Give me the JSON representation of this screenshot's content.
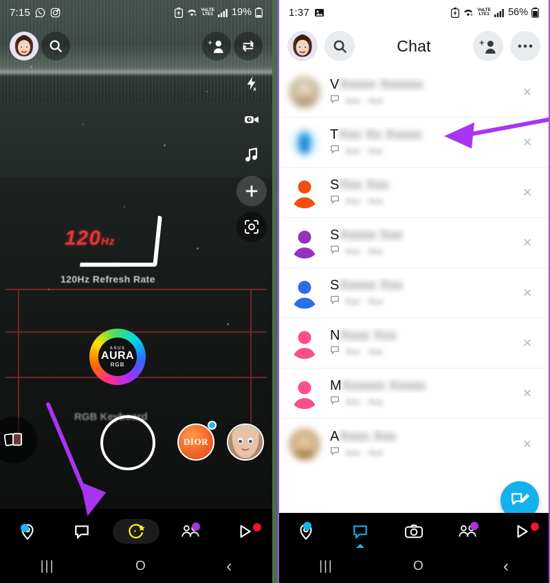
{
  "left_phone": {
    "statusbar": {
      "time": "7:15",
      "icons": [
        "whatsapp-icon",
        "instagram-icon"
      ],
      "right_icons": [
        "battery-saver-icon",
        "wifi-icon",
        "volte-icon",
        "signal-icon"
      ],
      "volte_top": "VoLTE",
      "volte_bottom": "LTE1",
      "battery_percent": "19%"
    },
    "camera": {
      "topbar": {
        "avatar": "bitmoji-avatar",
        "search": "search-icon",
        "add_friend": "add-friend-icon",
        "flip_camera": "flip-camera-icon"
      },
      "tools": [
        {
          "name": "flash-off-icon",
          "label": "Flash off"
        },
        {
          "name": "video-timer-icon",
          "label": "Timer"
        },
        {
          "name": "music-icon",
          "label": "Music"
        },
        {
          "name": "add-icon",
          "label": "Add"
        },
        {
          "name": "scan-icon",
          "label": "Scan"
        }
      ],
      "ar_overlay": {
        "headline": "120",
        "unit": "Hz",
        "caption": "120Hz Refresh Rate",
        "logo_brand": "ASUS",
        "logo_main": "AURA",
        "logo_sub": "RGB",
        "keyboard_text": "RGB Keyboard"
      },
      "carousel": {
        "memories": "memories-icon",
        "shutter": "shutter-button",
        "lenses": [
          {
            "name": "lens-dior",
            "label": "DIOR"
          },
          {
            "name": "lens-face",
            "label": ""
          }
        ]
      }
    },
    "bottom_nav": [
      {
        "name": "nav-map",
        "icon": "location-pin-icon",
        "active": false,
        "badge": ""
      },
      {
        "name": "nav-chat",
        "icon": "chat-bubble-icon",
        "active": false,
        "badge": "blue"
      },
      {
        "name": "nav-camera",
        "icon": "lens-smiley-icon",
        "active": true,
        "badge": ""
      },
      {
        "name": "nav-friends",
        "icon": "friends-icon",
        "active": false,
        "badge": "purple"
      },
      {
        "name": "nav-stories",
        "icon": "play-triangle-icon",
        "active": false,
        "badge": "red"
      }
    ],
    "system_nav": [
      {
        "name": "recents-button",
        "glyph": "|||"
      },
      {
        "name": "home-button",
        "glyph": "O"
      },
      {
        "name": "back-button",
        "glyph": "‹"
      }
    ]
  },
  "right_phone": {
    "statusbar": {
      "time": "1:37",
      "icons": [
        "photo-icon"
      ],
      "right_icons": [
        "battery-saver-icon",
        "wifi-icon",
        "volte-icon",
        "signal-icon"
      ],
      "volte_top": "VoLTE",
      "volte_bottom": "LTE1",
      "battery_percent": "56%"
    },
    "chat_header": {
      "avatar": "bitmoji-avatar",
      "search": "search-icon",
      "title": "Chat",
      "add_friend": "add-friend-icon",
      "more": "more-options-icon"
    },
    "chat_rows": [
      {
        "initial": "V",
        "name_blur": "Xxxxx Xxxxxx",
        "subtitle": "Xxx · Xxx",
        "avatar_type": "photo",
        "avatar_color": "#c8b49a",
        "close": "×"
      },
      {
        "initial": "T",
        "name_blur": "Xxx Xx Xxxxx",
        "subtitle": "Xxx · Xxx",
        "avatar_type": "photo",
        "avatar_color": "#57b6ef",
        "close": "×"
      },
      {
        "initial": "S",
        "name_blur": "Xxx Xxx",
        "subtitle": "Xxx · Xxx",
        "avatar_type": "silhouette",
        "avatar_color": "#f0500f",
        "close": "×"
      },
      {
        "initial": "S",
        "name_blur": "Xxxxx Xxx",
        "subtitle": "Xxx · Xxx",
        "avatar_type": "silhouette",
        "avatar_color": "#9333c0",
        "close": "×"
      },
      {
        "initial": "S",
        "name_blur": "Xxxxx Xxx",
        "subtitle": "Xxx · Xxx",
        "avatar_type": "silhouette",
        "avatar_color": "#2b6ee8",
        "close": "×"
      },
      {
        "initial": "N",
        "name_blur": "Xxxx Xxx",
        "subtitle": "Xxx · Xxx",
        "avatar_type": "silhouette",
        "avatar_color": "#fb4e8e",
        "close": "×"
      },
      {
        "initial": "M",
        "name_blur": "Xxxxxx Xxxxx",
        "subtitle": "Xxx · Xxx",
        "avatar_type": "silhouette",
        "avatar_color": "#fb4e8e",
        "close": "×"
      },
      {
        "initial": "A",
        "name_blur": "Xxxx Xxx",
        "subtitle": "Xxx · Xxx",
        "avatar_type": "photo",
        "avatar_color": "#c39a6b",
        "close": "×"
      }
    ],
    "fab": {
      "name": "new-chat-fab",
      "icon": "compose-chat-icon"
    },
    "bottom_nav": [
      {
        "name": "nav-map",
        "icon": "location-pin-icon",
        "active": false,
        "badge": ""
      },
      {
        "name": "nav-chat",
        "icon": "chat-bubble-icon",
        "active": true,
        "badge": "blue"
      },
      {
        "name": "nav-camera",
        "icon": "camera-icon",
        "active": false,
        "badge": ""
      },
      {
        "name": "nav-friends",
        "icon": "friends-icon",
        "active": false,
        "badge": "purple"
      },
      {
        "name": "nav-stories",
        "icon": "play-triangle-icon",
        "active": false,
        "badge": "red"
      }
    ],
    "system_nav": [
      {
        "name": "recents-button",
        "glyph": "|||"
      },
      {
        "name": "home-button",
        "glyph": "O"
      },
      {
        "name": "back-button",
        "glyph": "‹"
      }
    ]
  },
  "annotations": [
    {
      "name": "arrow-to-chat-tab",
      "color": "#a835f0",
      "direction": "down-right"
    },
    {
      "name": "arrow-to-chat-row",
      "color": "#a835f0",
      "direction": "left"
    }
  ],
  "colors": {
    "background": "#4e6b4f",
    "frame_border": "#a24de8",
    "snap_yellow": "#fffc00",
    "snap_blue": "#13b2ef",
    "badge_purple": "#a835d6",
    "badge_red": "#f11432",
    "arrow_purple": "#a835f0"
  }
}
